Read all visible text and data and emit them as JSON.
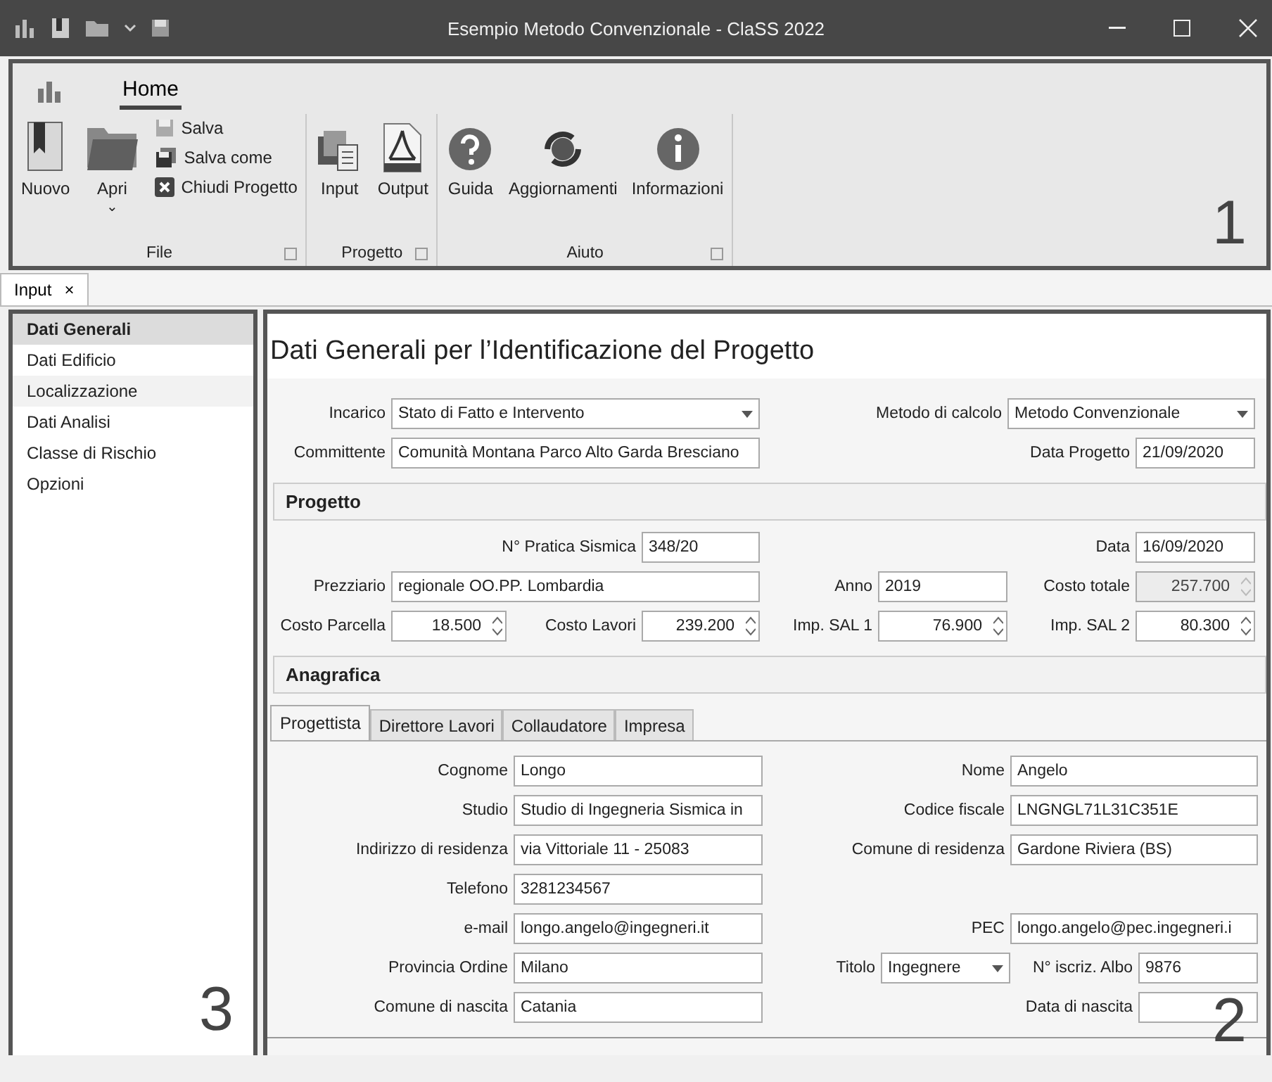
{
  "window": {
    "title": "Esempio Metodo Convenzionale - ClaSS 2022"
  },
  "ribbon": {
    "tabs": [
      {
        "label": "Home",
        "selected": true
      }
    ],
    "groups": [
      {
        "label": "File",
        "buttons": [
          {
            "label": "Nuovo",
            "kind": "large"
          },
          {
            "label": "Apri",
            "kind": "dropdown",
            "caret": "⌄"
          },
          {
            "label": "Salva",
            "kind": "small"
          },
          {
            "label": "Salva come",
            "kind": "small"
          },
          {
            "label": "Chiudi Progetto",
            "kind": "small"
          }
        ]
      },
      {
        "label": "Progetto",
        "buttons": [
          {
            "label": "Input",
            "kind": "large"
          },
          {
            "label": "Output",
            "kind": "large"
          }
        ]
      },
      {
        "label": "Aiuto",
        "buttons": [
          {
            "label": "Guida",
            "kind": "large"
          },
          {
            "label": "Aggiornamenti",
            "kind": "large"
          },
          {
            "label": "Informazioni",
            "kind": "large"
          }
        ]
      }
    ],
    "annotation": "1"
  },
  "document_tabs": [
    {
      "label": "Input",
      "close": "×",
      "selected": true
    }
  ],
  "sidebar": {
    "items": [
      {
        "label": "Dati Generali",
        "selected": true,
        "hovered": false
      },
      {
        "label": "Dati Edificio",
        "selected": false,
        "hovered": false
      },
      {
        "label": "Localizzazione",
        "selected": false,
        "hovered": true
      },
      {
        "label": "Dati Analisi",
        "selected": false,
        "hovered": false
      },
      {
        "label": "Classe di Rischio",
        "selected": false,
        "hovered": false
      },
      {
        "label": "Opzioni",
        "selected": false,
        "hovered": false
      }
    ],
    "annotation": "3"
  },
  "main": {
    "title": "Dati Generali per l’Identificazione del Progetto",
    "general_rows": [
      [
        {
          "label": "Incarico",
          "value": "Stato di Fatto e Intervento",
          "kind": "combo",
          "disabled": false
        },
        {
          "label": "Metodo di calcolo",
          "value": "Metodo Convenzionale",
          "kind": "combo",
          "disabled": false
        }
      ],
      [
        {
          "label": "Committente",
          "value": "Comunità Montana Parco Alto Garda Bresciano",
          "kind": "text",
          "disabled": false
        },
        {
          "label": "Data Progetto",
          "value": "21/09/2020",
          "kind": "text",
          "disabled": false
        }
      ]
    ],
    "progetto": {
      "heading": "Progetto",
      "rows": [
        [
          "",
          {
            "label": "N° Pratica Sismica",
            "value": "348/20",
            "kind": "text",
            "disabled": false
          },
          "",
          {
            "label": "Data",
            "value": "16/09/2020",
            "kind": "text",
            "disabled": false
          }
        ],
        [
          {
            "label": "Prezziario",
            "value": "regionale OO.PP. Lombardia",
            "kind": "text",
            "disabled": false
          },
          "",
          {
            "label": "Anno",
            "value": "2019",
            "kind": "text",
            "disabled": false
          },
          {
            "label": "Costo totale",
            "value": "257.700",
            "kind": "spin",
            "disabled": true
          }
        ],
        [
          {
            "label": "Costo Parcella",
            "value": "18.500",
            "kind": "spin",
            "disabled": false
          },
          {
            "label": "Costo Lavori",
            "value": "239.200",
            "kind": "spin",
            "disabled": false
          },
          {
            "label": "Imp. SAL 1",
            "value": "76.900",
            "kind": "spin",
            "disabled": false
          },
          {
            "label": "Imp. SAL 2",
            "value": "80.300",
            "kind": "spin",
            "disabled": false
          }
        ]
      ]
    },
    "anagrafica": {
      "heading": "Anagrafica",
      "tabs": [
        {
          "label": "Progettista",
          "selected": true
        },
        {
          "label": "Direttore Lavori",
          "selected": false
        },
        {
          "label": "Collaudatore",
          "selected": false
        },
        {
          "label": "Impresa",
          "selected": false
        }
      ],
      "rows": [
        [
          {
            "label": "Cognome",
            "value": "Longo",
            "kind": "text",
            "disabled": false
          },
          "",
          {
            "label": "Nome",
            "value": "Angelo",
            "kind": "text",
            "disabled": false
          }
        ],
        [
          {
            "label": "Studio",
            "value": "Studio di Ingegneria Sismica in",
            "kind": "text",
            "disabled": false
          },
          "",
          {
            "label": "Codice fiscale",
            "value": "LNGNGL71L31C351E",
            "kind": "text",
            "disabled": false
          }
        ],
        [
          {
            "label": "Indirizzo di residenza",
            "value": "via Vittoriale 11 - 25083",
            "kind": "text",
            "disabled": false
          },
          "",
          {
            "label": "Comune di residenza",
            "value": "Gardone Riviera (BS)",
            "kind": "text",
            "disabled": false
          }
        ],
        [
          {
            "label": "Telefono",
            "value": "3281234567",
            "kind": "text",
            "disabled": false
          }
        ],
        [
          {
            "label": "e-mail",
            "value": "longo.angelo@ingegneri.it",
            "kind": "text",
            "disabled": false
          },
          "",
          {
            "label": "PEC",
            "value": "longo.angelo@pec.ingegneri.i",
            "kind": "text",
            "disabled": false
          }
        ],
        [
          {
            "label": "Provincia Ordine",
            "value": "Milano",
            "kind": "text",
            "disabled": false
          },
          {
            "label": "Titolo",
            "value": "Ingegnere",
            "kind": "combo",
            "disabled": false
          },
          {
            "label": "N° iscriz. Albo",
            "value": "9876",
            "kind": "text",
            "disabled": false
          }
        ],
        [
          {
            "label": "Comune di nascita",
            "value": "Catania",
            "kind": "text",
            "disabled": false
          },
          "",
          {
            "label": "Data di nascita",
            "kind": "text",
            "disabled": false
          }
        ]
      ]
    },
    "annotation": "2"
  }
}
